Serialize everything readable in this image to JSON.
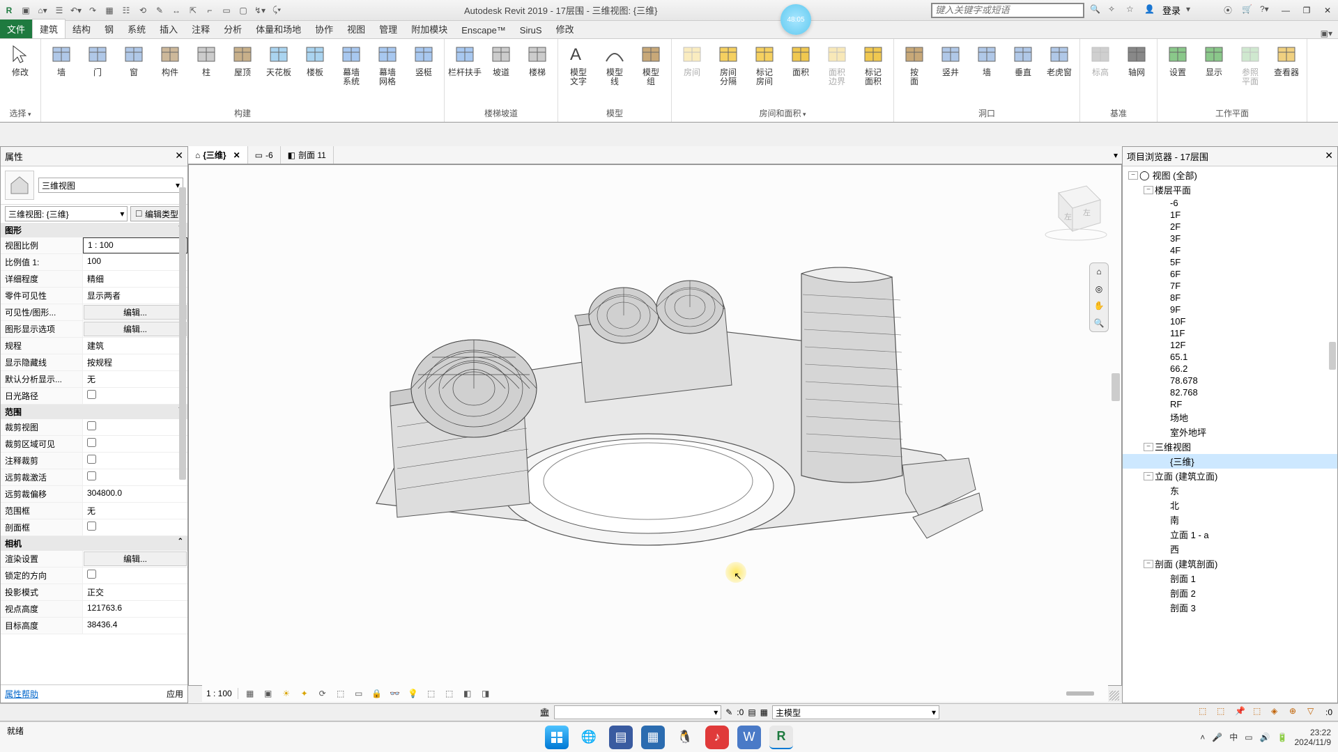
{
  "app": {
    "title": "Autodesk Revit 2019 - 17层围 - 三维视图: {三维}",
    "search_placeholder": "键入关键字或短语",
    "login": "登录",
    "badge": "48:05"
  },
  "ribbon": {
    "tabs": [
      "文件",
      "建筑",
      "结构",
      "钢",
      "系统",
      "插入",
      "注释",
      "分析",
      "体量和场地",
      "协作",
      "视图",
      "管理",
      "附加模块",
      "Enscape™",
      "SiruS",
      "修改"
    ],
    "active_tab": "建筑",
    "groups": [
      {
        "label": "选择",
        "drop": true,
        "buttons": [
          {
            "l": "修改",
            "ico": "cursor"
          }
        ]
      },
      {
        "label": "构建",
        "buttons": [
          {
            "l": "墙",
            "ico": "wall"
          },
          {
            "l": "门",
            "ico": "door"
          },
          {
            "l": "窗",
            "ico": "window"
          },
          {
            "l": "构件",
            "ico": "component"
          },
          {
            "l": "柱",
            "ico": "column"
          },
          {
            "l": "屋顶",
            "ico": "roof"
          },
          {
            "l": "天花板",
            "ico": "ceiling"
          },
          {
            "l": "楼板",
            "ico": "floor"
          },
          {
            "l": "幕墙\n系统",
            "ico": "curtain"
          },
          {
            "l": "幕墙\n网格",
            "ico": "grid"
          },
          {
            "l": "竖梃",
            "ico": "mullion"
          }
        ]
      },
      {
        "label": "楼梯坡道",
        "buttons": [
          {
            "l": "栏杆扶手",
            "ico": "rail"
          },
          {
            "l": "坡道",
            "ico": "ramp"
          },
          {
            "l": "楼梯",
            "ico": "stair"
          }
        ]
      },
      {
        "label": "模型",
        "buttons": [
          {
            "l": "模型\n文字",
            "ico": "text"
          },
          {
            "l": "模型\n线",
            "ico": "line"
          },
          {
            "l": "模型\n组",
            "ico": "group"
          }
        ]
      },
      {
        "label": "房间和面积",
        "drop": true,
        "buttons": [
          {
            "l": "房间",
            "ico": "room",
            "dis": true
          },
          {
            "l": "房间\n分隔",
            "ico": "roomsep"
          },
          {
            "l": "标记\n房间",
            "ico": "roomtag"
          },
          {
            "l": "面积",
            "ico": "area"
          },
          {
            "l": "面积\n边界",
            "ico": "areab",
            "dis": true
          },
          {
            "l": "标记\n面积",
            "ico": "areat"
          }
        ]
      },
      {
        "label": "洞口",
        "buttons": [
          {
            "l": "按\n面",
            "ico": "byface"
          },
          {
            "l": "竖井",
            "ico": "shaft"
          },
          {
            "l": "墙",
            "ico": "wallop"
          },
          {
            "l": "垂直",
            "ico": "vert"
          },
          {
            "l": "老虎窗",
            "ico": "dormer"
          }
        ]
      },
      {
        "label": "基准",
        "buttons": [
          {
            "l": "标高",
            "ico": "level",
            "dis": true
          },
          {
            "l": "轴网",
            "ico": "gridline"
          }
        ]
      },
      {
        "label": "工作平面",
        "buttons": [
          {
            "l": "设置",
            "ico": "set"
          },
          {
            "l": "显示",
            "ico": "show"
          },
          {
            "l": "参照\n平面",
            "ico": "ref",
            "dis": true
          },
          {
            "l": "查看器",
            "ico": "viewer"
          }
        ]
      }
    ]
  },
  "view_tabs": [
    {
      "label": "{三维}",
      "ico": "home",
      "active": true,
      "closable": true
    },
    {
      "label": "-6",
      "ico": "plan"
    },
    {
      "label": "剖面 11",
      "ico": "section"
    }
  ],
  "properties": {
    "title": "属性",
    "type_name": "三维视图",
    "instance": "三维视图: {三维}",
    "edit_type": "编辑类型",
    "help": "属性帮助",
    "apply": "应用",
    "sections": [
      {
        "name": "图形",
        "rows": [
          {
            "n": "视图比例",
            "v": "1 : 100",
            "boxed": true
          },
          {
            "n": "比例值 1:",
            "v": "100"
          },
          {
            "n": "详细程度",
            "v": "精细"
          },
          {
            "n": "零件可见性",
            "v": "显示两者"
          },
          {
            "n": "可见性/图形...",
            "v": "编辑...",
            "btn": true
          },
          {
            "n": "图形显示选项",
            "v": "编辑...",
            "btn": true
          },
          {
            "n": "规程",
            "v": "建筑"
          },
          {
            "n": "显示隐藏线",
            "v": "按规程"
          },
          {
            "n": "默认分析显示...",
            "v": "无"
          },
          {
            "n": "日光路径",
            "v": "",
            "chk": false
          }
        ]
      },
      {
        "name": "范围",
        "rows": [
          {
            "n": "裁剪视图",
            "v": "",
            "chk": false
          },
          {
            "n": "裁剪区域可见",
            "v": "",
            "chk": false
          },
          {
            "n": "注释裁剪",
            "v": "",
            "chk": false
          },
          {
            "n": "远剪裁激活",
            "v": "",
            "chk": false
          },
          {
            "n": "远剪裁偏移",
            "v": "304800.0"
          },
          {
            "n": "范围框",
            "v": "无"
          },
          {
            "n": "剖面框",
            "v": "",
            "chk": false
          }
        ]
      },
      {
        "name": "相机",
        "rows": [
          {
            "n": "渲染设置",
            "v": "编辑...",
            "btn": true
          },
          {
            "n": "锁定的方向",
            "v": "",
            "chk": false
          },
          {
            "n": "投影模式",
            "v": "正交"
          },
          {
            "n": "视点高度",
            "v": "121763.6"
          },
          {
            "n": "目标高度",
            "v": "38436.4"
          }
        ]
      }
    ]
  },
  "view_ctrl": {
    "scale": "1 : 100"
  },
  "option_bar": {
    "coord": ":0",
    "model": "主模型",
    "filter_count": ":0"
  },
  "status": {
    "text": "就绪"
  },
  "browser": {
    "title": "项目浏览器 - 17层围",
    "tree": [
      {
        "d": 0,
        "t": "-",
        "l": "视图 (全部)",
        "ico": "o"
      },
      {
        "d": 1,
        "t": "-",
        "l": "楼层平面"
      },
      {
        "d": 2,
        "l": "-6"
      },
      {
        "d": 2,
        "l": "1F"
      },
      {
        "d": 2,
        "l": "2F"
      },
      {
        "d": 2,
        "l": "3F"
      },
      {
        "d": 2,
        "l": "4F"
      },
      {
        "d": 2,
        "l": "5F"
      },
      {
        "d": 2,
        "l": "6F"
      },
      {
        "d": 2,
        "l": "7F"
      },
      {
        "d": 2,
        "l": "8F"
      },
      {
        "d": 2,
        "l": "9F"
      },
      {
        "d": 2,
        "l": "10F"
      },
      {
        "d": 2,
        "l": "11F"
      },
      {
        "d": 2,
        "l": "12F"
      },
      {
        "d": 2,
        "l": "65.1"
      },
      {
        "d": 2,
        "l": "66.2"
      },
      {
        "d": 2,
        "l": "78.678"
      },
      {
        "d": 2,
        "l": "82.768"
      },
      {
        "d": 2,
        "l": "RF"
      },
      {
        "d": 2,
        "l": "场地"
      },
      {
        "d": 2,
        "l": "室外地坪"
      },
      {
        "d": 1,
        "t": "-",
        "l": "三维视图"
      },
      {
        "d": 2,
        "l": "{三维}",
        "sel": true
      },
      {
        "d": 1,
        "t": "-",
        "l": "立面 (建筑立面)"
      },
      {
        "d": 2,
        "l": "东"
      },
      {
        "d": 2,
        "l": "北"
      },
      {
        "d": 2,
        "l": "南"
      },
      {
        "d": 2,
        "l": "立面 1 - a"
      },
      {
        "d": 2,
        "l": "西"
      },
      {
        "d": 1,
        "t": "-",
        "l": "剖面 (建筑剖面)"
      },
      {
        "d": 2,
        "l": "剖面 1"
      },
      {
        "d": 2,
        "l": "剖面 2"
      },
      {
        "d": 2,
        "l": "剖面 3"
      }
    ]
  },
  "taskbar": {
    "time": "23:22",
    "date": "2024/11/9",
    "ime": "中"
  }
}
